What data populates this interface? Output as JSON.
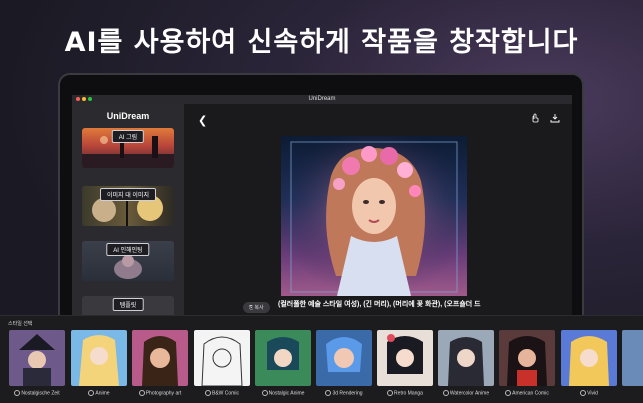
{
  "promo": {
    "title": "AI를 사용하여 신속하게 작품을 창작합니다"
  },
  "window": {
    "title": "UniDream"
  },
  "sidebar": {
    "logo": "niDream",
    "logo_mark": "U",
    "items": [
      {
        "label": "AI 그림"
      },
      {
        "label": "이미지 대 이미지"
      },
      {
        "label": "AI 인해인팅"
      },
      {
        "label": "템플릿"
      }
    ]
  },
  "main": {
    "copy_label": "복사",
    "prompt": "(컬러풀한 예술 스타일 여성), (긴 머리), (머리에 꽃 화관), (오프숄더 드"
  },
  "styles": {
    "header": "스타일 선택",
    "items": [
      {
        "label": "Nostalgische Zeit"
      },
      {
        "label": "Anime"
      },
      {
        "label": "Photography art"
      },
      {
        "label": "B&W Comic"
      },
      {
        "label": "Nostalgic Anime"
      },
      {
        "label": "3d Rendering"
      },
      {
        "label": "Retro Manga"
      },
      {
        "label": "Watercolor Anime"
      },
      {
        "label": "American Comic"
      },
      {
        "label": "Vivid"
      }
    ]
  },
  "colors": {
    "accent": "#ffffff",
    "panel": "#1c1c1f",
    "sidebar": "#2a2a2f"
  }
}
